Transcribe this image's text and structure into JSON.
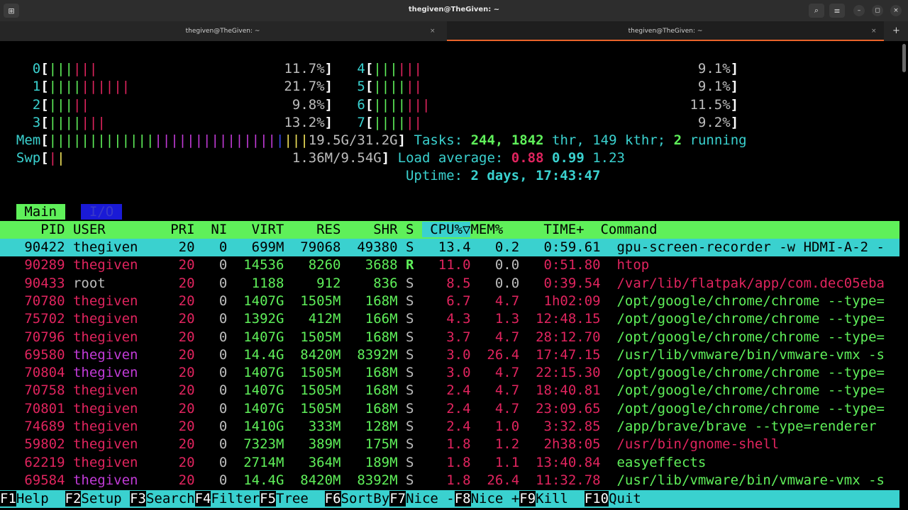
{
  "window": {
    "title": "thegiven@TheGiven: ~",
    "tabs": [
      {
        "label": "thegiven@TheGiven: ~",
        "active": false
      },
      {
        "label": "thegiven@TheGiven: ~",
        "active": true
      }
    ],
    "close_glyph": "×",
    "icons": {
      "new_tab": "new-tab-icon",
      "search": "search-icon",
      "menu": "hamburger-menu-icon",
      "minimize": "minimize-icon",
      "maximize": "maximize-icon",
      "close": "close-icon"
    }
  },
  "meters": {
    "cpus": [
      {
        "id": "0",
        "percent": "11.7%"
      },
      {
        "id": "1",
        "percent": "21.7%"
      },
      {
        "id": "2",
        "percent": "9.8%"
      },
      {
        "id": "3",
        "percent": "13.2%"
      },
      {
        "id": "4",
        "percent": "9.1%"
      },
      {
        "id": "5",
        "percent": "9.1%"
      },
      {
        "id": "6",
        "percent": "11.5%"
      },
      {
        "id": "7",
        "percent": "9.2%"
      }
    ],
    "mem": {
      "label": "Mem",
      "value": "19.5G/31.2G"
    },
    "swp": {
      "label": "Swp",
      "value": "1.36M/9.54G"
    }
  },
  "summary": {
    "tasks_label": "Tasks:",
    "tasks": "244,",
    "threads": "1842",
    "thr_label": "thr,",
    "kthreads": "149",
    "kthr_label": "kthr;",
    "running": "2",
    "running_label": "running",
    "load_label": "Load average:",
    "load1": "0.88",
    "load5": "0.99",
    "load15": "1.23",
    "uptime_label": "Uptime:",
    "uptime": "2 days, 17:43:47"
  },
  "screen_tabs": {
    "main": "Main",
    "io": "I/O"
  },
  "columns": [
    "PID",
    "USER",
    "PRI",
    "NI",
    "VIRT",
    "RES",
    "SHR",
    "S",
    "CPU%▽",
    "MEM%",
    "TIME+",
    "Command"
  ],
  "processes": [
    {
      "pid": "90422",
      "user": "thegiven",
      "pri": "20",
      "ni": "0",
      "virt": "699M",
      "res": "79068",
      "shr": "49380",
      "s": "S",
      "cpu": "13.4",
      "mem": "0.2",
      "time": "0:59.61",
      "cmd": "gpu-screen-recorder -w HDMI-A-2 -",
      "selected": true
    },
    {
      "pid": "90289",
      "user": "thegiven",
      "pri": "20",
      "ni": "0",
      "virt": "14536",
      "res": "8260",
      "shr": "3688",
      "s": "R",
      "cpu": "11.0",
      "mem": "0.0",
      "time": "0:51.80",
      "cmd": "htop"
    },
    {
      "pid": "90433",
      "user": "root",
      "pri": "20",
      "ni": "0",
      "virt": "1188",
      "res": "912",
      "shr": "836",
      "s": "S",
      "cpu": "8.5",
      "mem": "0.0",
      "time": "0:39.54",
      "cmd": "/var/lib/flatpak/app/com.dec05eba"
    },
    {
      "pid": "70780",
      "user": "thegiven",
      "pri": "20",
      "ni": "0",
      "virt": "1407G",
      "res": "1505M",
      "shr": "168M",
      "s": "S",
      "cpu": "6.7",
      "mem": "4.7",
      "time": "1h02:09",
      "cmd": "/opt/google/chrome/chrome --type="
    },
    {
      "pid": "75702",
      "user": "thegiven",
      "pri": "20",
      "ni": "0",
      "virt": "1392G",
      "res": "412M",
      "shr": "166M",
      "s": "S",
      "cpu": "4.3",
      "mem": "1.3",
      "time": "12:48.15",
      "cmd": "/opt/google/chrome/chrome --type="
    },
    {
      "pid": "70796",
      "user": "thegiven",
      "pri": "20",
      "ni": "0",
      "virt": "1407G",
      "res": "1505M",
      "shr": "168M",
      "s": "S",
      "cpu": "3.7",
      "mem": "4.7",
      "time": "28:12.70",
      "cmd": "/opt/google/chrome/chrome --type="
    },
    {
      "pid": "69580",
      "user": "thegiven",
      "pri": "20",
      "ni": "0",
      "virt": "14.4G",
      "res": "8420M",
      "shr": "8392M",
      "s": "S",
      "cpu": "3.0",
      "mem": "26.4",
      "time": "17:47.15",
      "cmd": "/usr/lib/vmware/bin/vmware-vmx -s"
    },
    {
      "pid": "70804",
      "user": "thegiven",
      "pri": "20",
      "ni": "0",
      "virt": "1407G",
      "res": "1505M",
      "shr": "168M",
      "s": "S",
      "cpu": "3.0",
      "mem": "4.7",
      "time": "22:15.30",
      "cmd": "/opt/google/chrome/chrome --type="
    },
    {
      "pid": "70758",
      "user": "thegiven",
      "pri": "20",
      "ni": "0",
      "virt": "1407G",
      "res": "1505M",
      "shr": "168M",
      "s": "S",
      "cpu": "2.4",
      "mem": "4.7",
      "time": "18:40.81",
      "cmd": "/opt/google/chrome/chrome --type="
    },
    {
      "pid": "70801",
      "user": "thegiven",
      "pri": "20",
      "ni": "0",
      "virt": "1407G",
      "res": "1505M",
      "shr": "168M",
      "s": "S",
      "cpu": "2.4",
      "mem": "4.7",
      "time": "23:09.65",
      "cmd": "/opt/google/chrome/chrome --type="
    },
    {
      "pid": "74689",
      "user": "thegiven",
      "pri": "20",
      "ni": "0",
      "virt": "1410G",
      "res": "333M",
      "shr": "128M",
      "s": "S",
      "cpu": "2.4",
      "mem": "1.0",
      "time": "3:32.85",
      "cmd": "/app/brave/brave --type=renderer"
    },
    {
      "pid": "59802",
      "user": "thegiven",
      "pri": "20",
      "ni": "0",
      "virt": "7323M",
      "res": "389M",
      "shr": "175M",
      "s": "S",
      "cpu": "1.8",
      "mem": "1.2",
      "time": "2h38:05",
      "cmd": "/usr/bin/gnome-shell"
    },
    {
      "pid": "62219",
      "user": "thegiven",
      "pri": "20",
      "ni": "0",
      "virt": "2714M",
      "res": "364M",
      "shr": "189M",
      "s": "S",
      "cpu": "1.8",
      "mem": "1.1",
      "time": "13:40.84",
      "cmd": "easyeffects"
    },
    {
      "pid": "69584",
      "user": "thegiven",
      "pri": "20",
      "ni": "0",
      "virt": "14.4G",
      "res": "8420M",
      "shr": "8392M",
      "s": "S",
      "cpu": "1.8",
      "mem": "26.4",
      "time": "11:32.78",
      "cmd": "/usr/lib/vmware/bin/vmware-vmx -s"
    }
  ],
  "function_keys": [
    {
      "key": "F1",
      "label": "Help"
    },
    {
      "key": "F2",
      "label": "Setup"
    },
    {
      "key": "F3",
      "label": "Search"
    },
    {
      "key": "F4",
      "label": "Filter"
    },
    {
      "key": "F5",
      "label": "Tree"
    },
    {
      "key": "F6",
      "label": "SortBy"
    },
    {
      "key": "F7",
      "label": "Nice -"
    },
    {
      "key": "F8",
      "label": "Nice +"
    },
    {
      "key": "F9",
      "label": "Kill"
    },
    {
      "key": "F10",
      "label": "Quit"
    }
  ]
}
